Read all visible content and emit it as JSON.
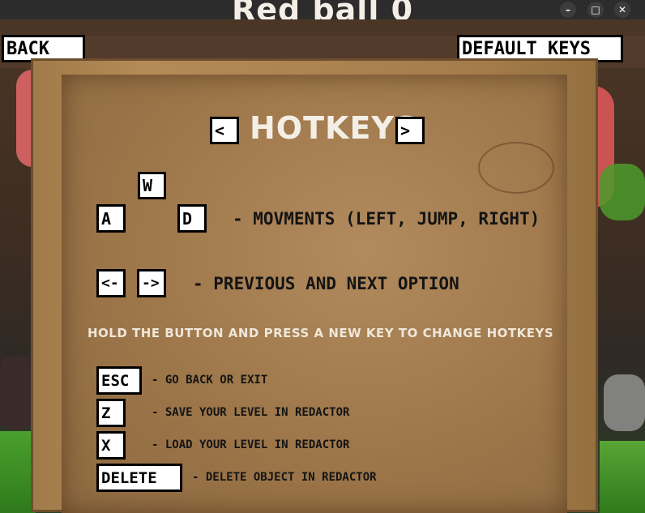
{
  "window": {
    "title": "Red ball 0",
    "min_glyph": "–",
    "max_glyph": "□",
    "close_glyph": "✕"
  },
  "topbar": {
    "back_label": "BACK",
    "default_keys_label": "DEFAULT KEYS"
  },
  "panel": {
    "title": "HOTKEYS",
    "prev_arrow": "<",
    "next_arrow": ">",
    "movement": {
      "keys": {
        "up": "W",
        "left": "A",
        "right": "D"
      },
      "description": "- MOVMENTS (LEFT, JUMP, RIGHT)"
    },
    "options": {
      "keys": {
        "prev": "<-",
        "next": "->"
      },
      "description": "- PREVIOUS AND NEXT OPTION"
    },
    "hint": "HOLD THE BUTTON AND PRESS A NEW KEY TO CHANGE HOTKEYS",
    "bindings": [
      {
        "key": "ESC",
        "description": "- GO BACK OR EXIT"
      },
      {
        "key": "Z",
        "description": "- SAVE YOUR LEVEL IN REDACTOR"
      },
      {
        "key": "X",
        "description": "- LOAD YOUR LEVEL IN REDACTOR"
      },
      {
        "key": "DELETE",
        "description": "- DELETE OBJECT IN REDACTOR"
      }
    ]
  }
}
